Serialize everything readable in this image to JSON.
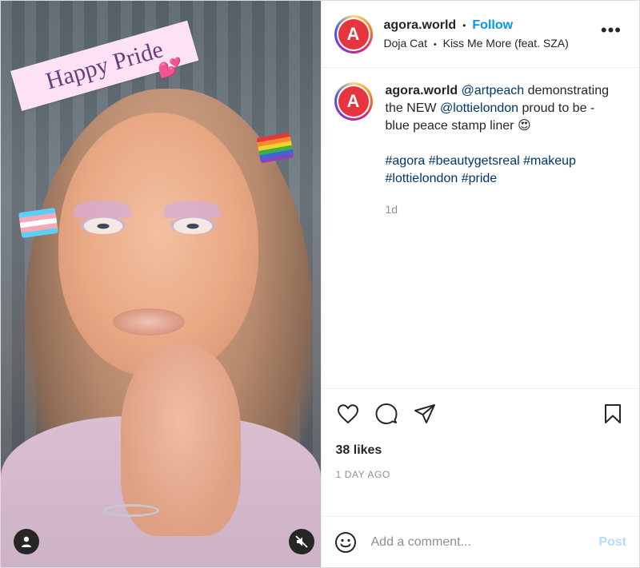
{
  "media": {
    "sticker_text": "Happy Pride",
    "sticker_hearts": "💕"
  },
  "header": {
    "avatar_letter": "A",
    "username": "agora.world",
    "separator": "•",
    "follow_label": "Follow",
    "artist": "Doja Cat",
    "song_separator": "•",
    "song": "Kiss Me More (feat. SZA)",
    "more_label": "•••"
  },
  "caption": {
    "username": "agora.world",
    "mention_1": "@artpeach",
    "text_1": "demonstrating the NEW",
    "mention_2": "@lottielondon",
    "text_2": "proud to be - blue peace stamp liner",
    "emoji": "😍",
    "hashtags": [
      "#agora",
      "#beautygetsreal",
      "#makeup",
      "#lottielondon",
      "#pride"
    ],
    "time": "1d"
  },
  "actions": {
    "likes": "38 likes",
    "posted": "1 DAY AGO"
  },
  "comment": {
    "placeholder": "Add a comment...",
    "post_label": "Post"
  },
  "colors": {
    "follow": "#0095f6",
    "link": "#00376b",
    "post_disabled": "#b3dbff",
    "muted": "#8e8e8e"
  }
}
